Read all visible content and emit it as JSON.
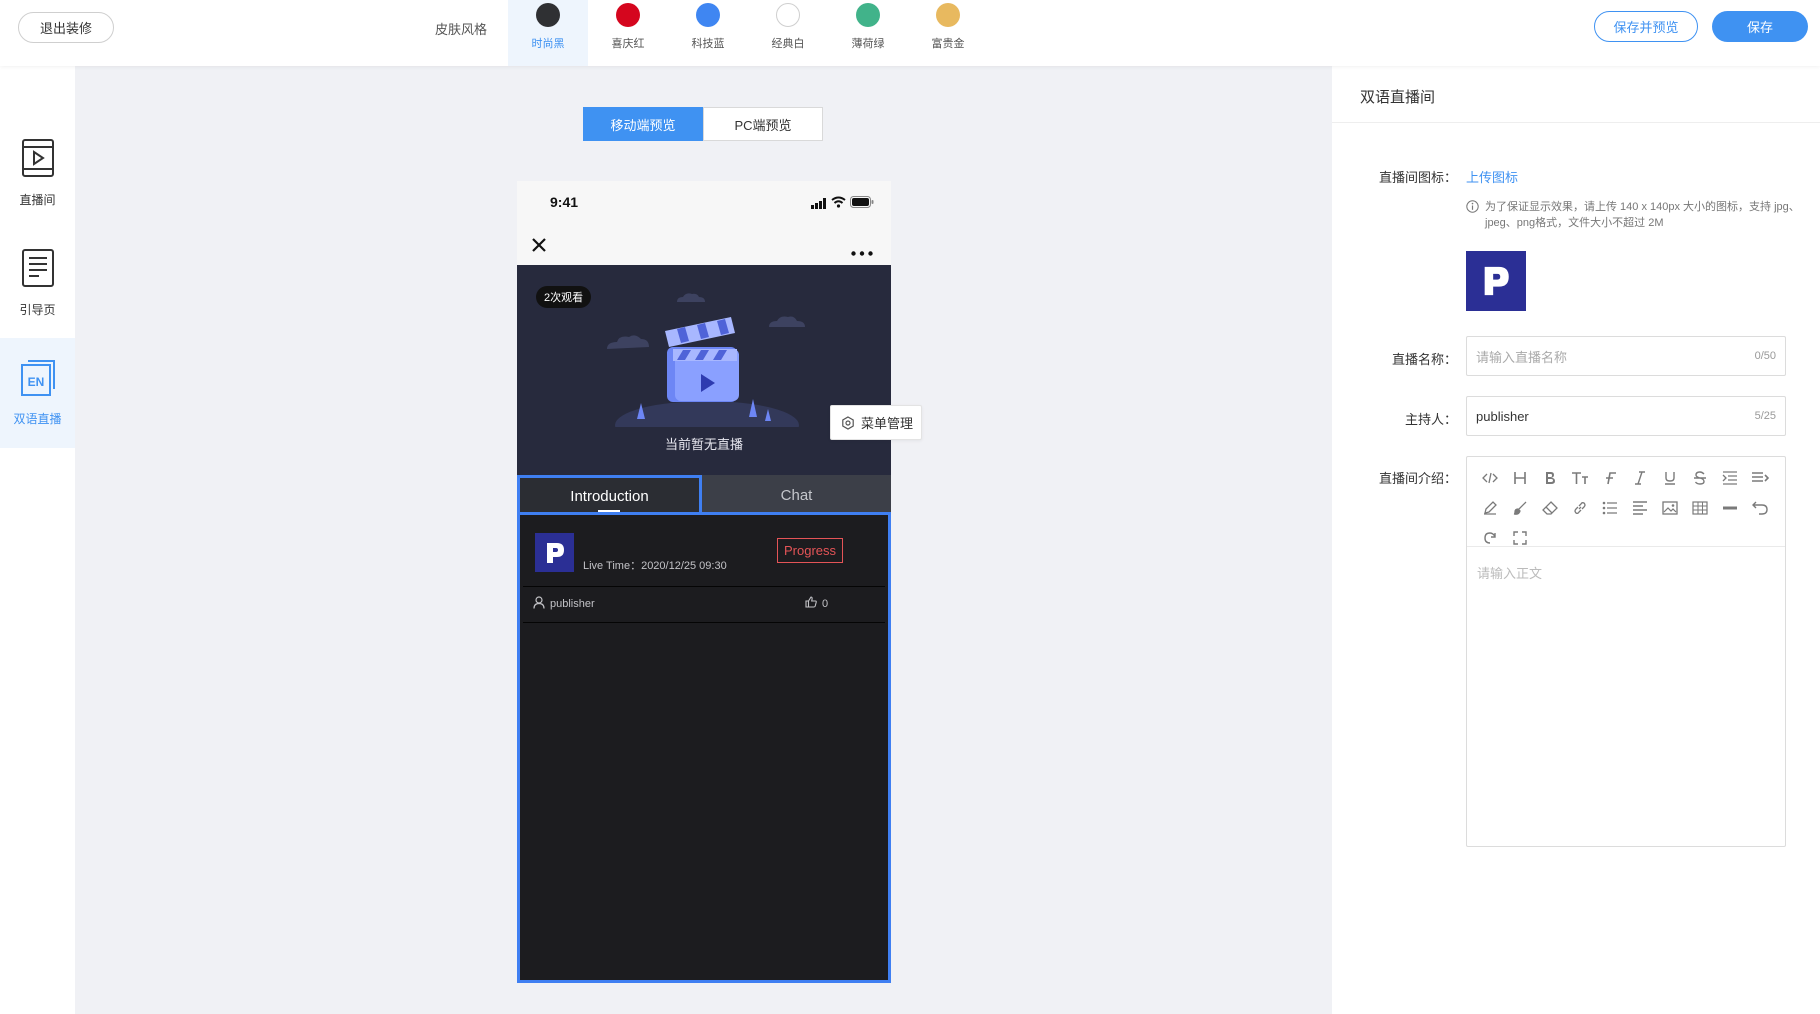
{
  "topbar": {
    "exit_label": "退出装修",
    "skin_label": "皮肤风格",
    "skins": [
      {
        "label": "时尚黑",
        "color": "#2f3033",
        "active": true
      },
      {
        "label": "喜庆红",
        "color": "#d5061e",
        "active": false
      },
      {
        "label": "科技蓝",
        "color": "#3f86f2",
        "active": false
      },
      {
        "label": "经典白",
        "color": "#ffffff",
        "active": false
      },
      {
        "label": "薄荷绿",
        "color": "#41b38a",
        "active": false
      },
      {
        "label": "富贵金",
        "color": "#e8b95f",
        "active": false
      }
    ],
    "save_preview_label": "保存并预览",
    "save_label": "保存"
  },
  "sidebar": {
    "items": [
      {
        "label": "直播间",
        "icon": "play-screen-icon",
        "active": false
      },
      {
        "label": "引导页",
        "icon": "document-icon",
        "active": false
      },
      {
        "label": "双语直播",
        "icon": "en-bilingual-icon",
        "active": true
      }
    ]
  },
  "preview": {
    "mobile_label": "移动端预览",
    "pc_label": "PC端预览",
    "active": "mobile"
  },
  "phone": {
    "time": "9:41",
    "views_badge": "2次观看",
    "no_live_text": "当前暂无直播",
    "tabs": [
      {
        "label": "Introduction",
        "active": true
      },
      {
        "label": "Chat",
        "active": false
      }
    ],
    "live_time": "Live Time：2020/12/25 09:30",
    "status_badge": "Progress",
    "publisher": "publisher",
    "likes": "0"
  },
  "menu_manage_label": "菜单管理",
  "panel": {
    "title": "双语直播间",
    "icon_label": "直播间图标：",
    "upload_label": "上传图标",
    "hint": "为了保证显示效果，请上传 140 x 140px 大小的图标，支持 jpg、jpeg、png格式，文件大小不超过 2M",
    "name_label": "直播名称：",
    "name_placeholder": "请输入直播名称",
    "name_count": "0/50",
    "host_label": "主持人：",
    "host_value": "publisher",
    "host_count": "5/25",
    "intro_label": "直播间介绍：",
    "editor_placeholder": "请输入正文",
    "toolbar_icons": [
      "code-icon",
      "heading-icon",
      "bold-icon",
      "font-size-icon",
      "font-icon",
      "italic-icon",
      "underline-icon",
      "strikethrough-icon",
      "indent-icon",
      "line-height-icon",
      "pen-icon",
      "brush-icon",
      "eraser-icon",
      "link-icon",
      "list-icon",
      "align-icon",
      "image-icon",
      "table-icon",
      "divider-icon",
      "undo-icon",
      "redo-icon",
      "fullscreen-icon"
    ]
  }
}
